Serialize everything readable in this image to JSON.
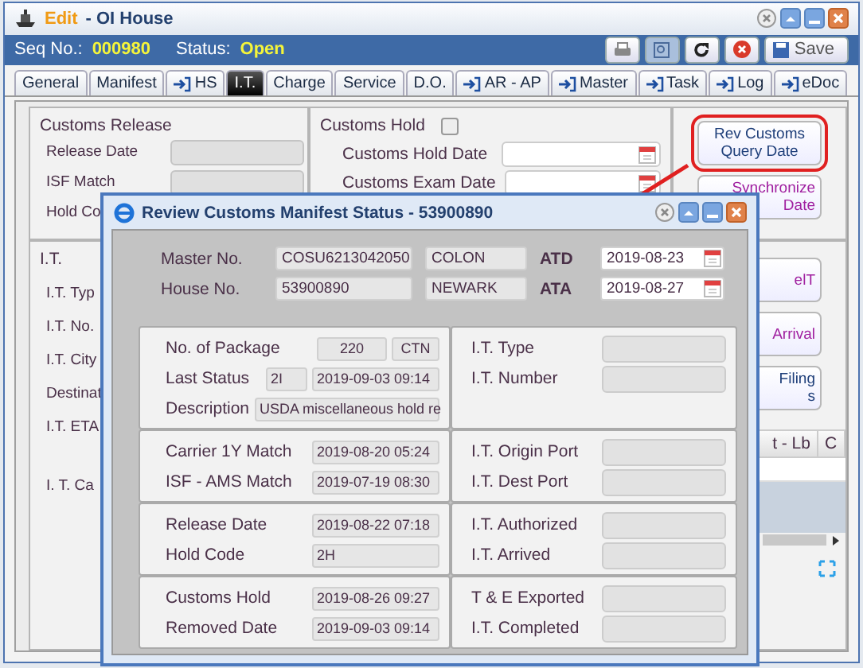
{
  "window": {
    "mode": "Edit",
    "title": "- OI House"
  },
  "header": {
    "seq_label": "Seq No.:",
    "seq": "000980",
    "status_label": "Status:",
    "status": "Open"
  },
  "toolbar": [
    {
      "kind": "print",
      "selected": false
    },
    {
      "kind": "find",
      "selected": true
    },
    {
      "kind": "refresh",
      "selected": false
    },
    {
      "kind": "close",
      "selected": false
    },
    {
      "kind": "save",
      "selected": false,
      "label": "Save"
    }
  ],
  "tabs": [
    {
      "label": "General",
      "selected": false,
      "linked": false
    },
    {
      "label": "Manifest",
      "selected": false,
      "linked": false
    },
    {
      "label": "HS",
      "selected": false,
      "linked": true
    },
    {
      "label": "I.T.",
      "selected": true,
      "linked": false
    },
    {
      "label": "Charge",
      "selected": false,
      "linked": false
    },
    {
      "label": "Service",
      "selected": false,
      "linked": false
    },
    {
      "label": "D.O.",
      "selected": false,
      "linked": false
    },
    {
      "label": "AR - AP",
      "selected": false,
      "linked": true
    },
    {
      "label": "Master",
      "selected": false,
      "linked": true
    },
    {
      "label": "Task",
      "selected": false,
      "linked": true
    },
    {
      "label": "Log",
      "selected": false,
      "linked": true
    },
    {
      "label": "eDoc",
      "selected": false,
      "linked": true
    }
  ],
  "customs_release": {
    "title": "Customs Release",
    "fields": [
      {
        "label": "Release Date",
        "kind": "input"
      },
      {
        "label": "ISF Match",
        "kind": "input"
      },
      {
        "label": "Hold Co",
        "kind": "label"
      }
    ]
  },
  "customs_hold": {
    "title": "Customs Hold",
    "checked": false,
    "fields": [
      {
        "label": "Customs Hold Date"
      },
      {
        "label": "Customs Exam Date"
      }
    ]
  },
  "side_buttons": [
    {
      "kind": "full",
      "highlighted": true,
      "color": "#1f3f7a",
      "lines": [
        "Rev Customs",
        "Query Date"
      ]
    },
    {
      "kind": "cut",
      "highlighted": false,
      "color": "#a020a0",
      "lines": [
        "Synchronize",
        "Date"
      ]
    }
  ],
  "it_section": {
    "title": "I.T.",
    "labels": [
      "I.T. Typ",
      "I.T. No.",
      "I.T. City",
      "Destinat",
      "I.T. ETA",
      "I. T. Ca"
    ]
  },
  "it_buttons": [
    {
      "color": "#a020a0",
      "lines": [
        "elT"
      ]
    },
    {
      "color": "#a020a0",
      "lines": [
        "Arrival"
      ]
    },
    {
      "color": "#1f3f7a",
      "lines": [
        "Filing",
        "s"
      ]
    }
  ],
  "grid": {
    "columns": [
      "t - Lb",
      "C"
    ]
  },
  "dialog": {
    "title": "Review Customs Manifest Status - 53900890",
    "top_rows": [
      {
        "label": "Master No.",
        "value": "COSU6213042050",
        "port": "COLON",
        "date_label": "ATD",
        "date": "2019-08-23"
      },
      {
        "label": "House No.",
        "value": "53900890",
        "port": "NEWARK",
        "date_label": "ATA",
        "date": "2019-08-27"
      }
    ],
    "sections": [
      {
        "left": [
          {
            "kind": "count",
            "label": "No. of Package",
            "values": [
              "220",
              "CTN"
            ]
          },
          {
            "kind": "status",
            "label": "Last Status",
            "values": [
              "2I",
              "2019-09-03 09:14"
            ]
          },
          {
            "kind": "text",
            "label": "Description",
            "values": [
              "USDA miscellaneous hold re"
            ]
          }
        ],
        "right": [
          {
            "kind": "empty",
            "label": "I.T. Type"
          },
          {
            "kind": "empty",
            "label": "I.T. Number"
          }
        ]
      },
      {
        "left": [
          {
            "kind": "date",
            "label": "Carrier 1Y Match",
            "values": [
              "2019-08-20 05:24"
            ]
          },
          {
            "kind": "date",
            "label": "ISF - AMS Match",
            "values": [
              "2019-07-19 08:30"
            ]
          }
        ],
        "right": [
          {
            "kind": "empty",
            "label": "I.T. Origin Port"
          },
          {
            "kind": "empty",
            "label": "I.T. Dest Port"
          }
        ]
      },
      {
        "left": [
          {
            "kind": "date",
            "label": "Release Date",
            "values": [
              "2019-08-22 07:18"
            ]
          },
          {
            "kind": "date",
            "label": "Hold Code",
            "values": [
              "2H"
            ]
          }
        ],
        "right": [
          {
            "kind": "empty",
            "label": "I.T. Authorized"
          },
          {
            "kind": "empty",
            "label": "I.T. Arrived"
          }
        ]
      },
      {
        "left": [
          {
            "kind": "date",
            "label": "Customs Hold",
            "values": [
              "2019-08-26 09:27"
            ]
          },
          {
            "kind": "date",
            "label": "Removed Date",
            "values": [
              "2019-09-03 09:14"
            ]
          }
        ],
        "right": [
          {
            "kind": "empty",
            "label": "T & E Exported"
          },
          {
            "kind": "empty",
            "label": "I.T. Completed"
          }
        ]
      }
    ]
  }
}
